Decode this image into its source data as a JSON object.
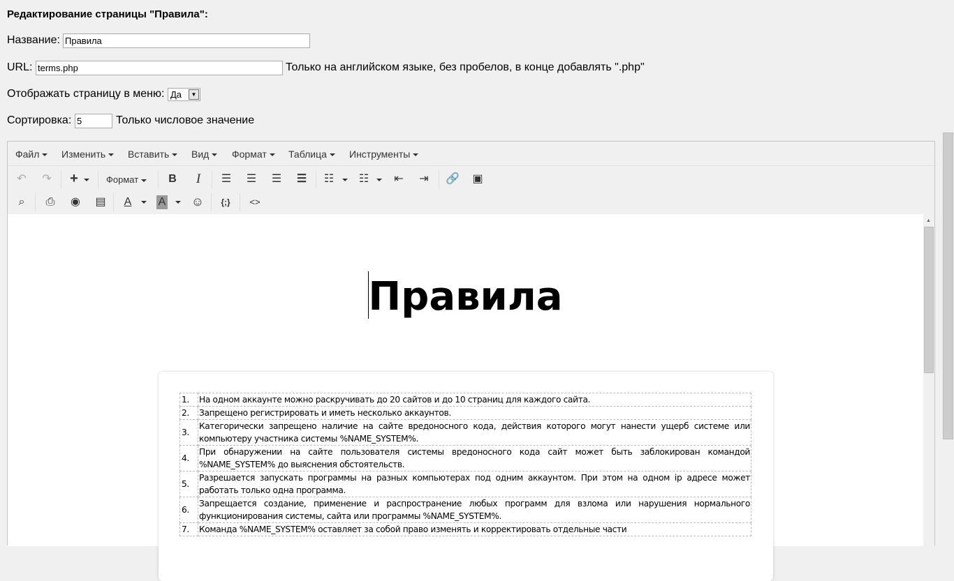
{
  "page_title": "Редактирование страницы \"Правила\":",
  "form": {
    "name_label": "Название:",
    "name_value": "Правила",
    "url_label": "URL:",
    "url_value": "terms.php",
    "url_hint": "Только на английском языке, без пробелов, в конце добавлять \".php\"",
    "menu_label": "Отображать страницу в меню:",
    "menu_value": "Да",
    "sort_label": "Сортировка:",
    "sort_value": "5",
    "sort_hint": "Только числовое значение"
  },
  "editor": {
    "menu": [
      "Файл",
      "Изменить",
      "Вставить",
      "Вид",
      "Формат",
      "Таблица",
      "Инструменты"
    ],
    "format_dropdown": "Формат",
    "heading": "Правила",
    "rules": [
      {
        "n": "1.",
        "text": "На одном аккаунте можно раскручивать до 20 сайтов и до 10 страниц для каждого сайта."
      },
      {
        "n": "2.",
        "text": "Запрещено регистрировать и иметь несколько аккаунтов."
      },
      {
        "n": "3.",
        "text": "Категорически запрещено наличие на сайте вредоносного кода, действия которого могут нанести ущерб системе или компьютеру участника системы %NAME_SYSTEM%."
      },
      {
        "n": "4.",
        "text": "При обнаружении на сайте пользователя системы вредоносного кода сайт может быть заблокирован командой %NAME_SYSTEM% до выяснения обстоятельств."
      },
      {
        "n": "5.",
        "text": "Разрешается запускать программы на разных компьютерах под одним аккаунтом. При этом на одном ip адресе может работать только одна программа."
      },
      {
        "n": "6.",
        "text": "Запрещается создание, применение и распространение любых программ для взлома или нарушения нормального функционирования системы, сайта или программы %NAME_SYSTEM%."
      },
      {
        "n": "7.",
        "text": "Команда %NAME_SYSTEM% оставляет за собой право изменять и корректировать отдельные части"
      }
    ]
  }
}
